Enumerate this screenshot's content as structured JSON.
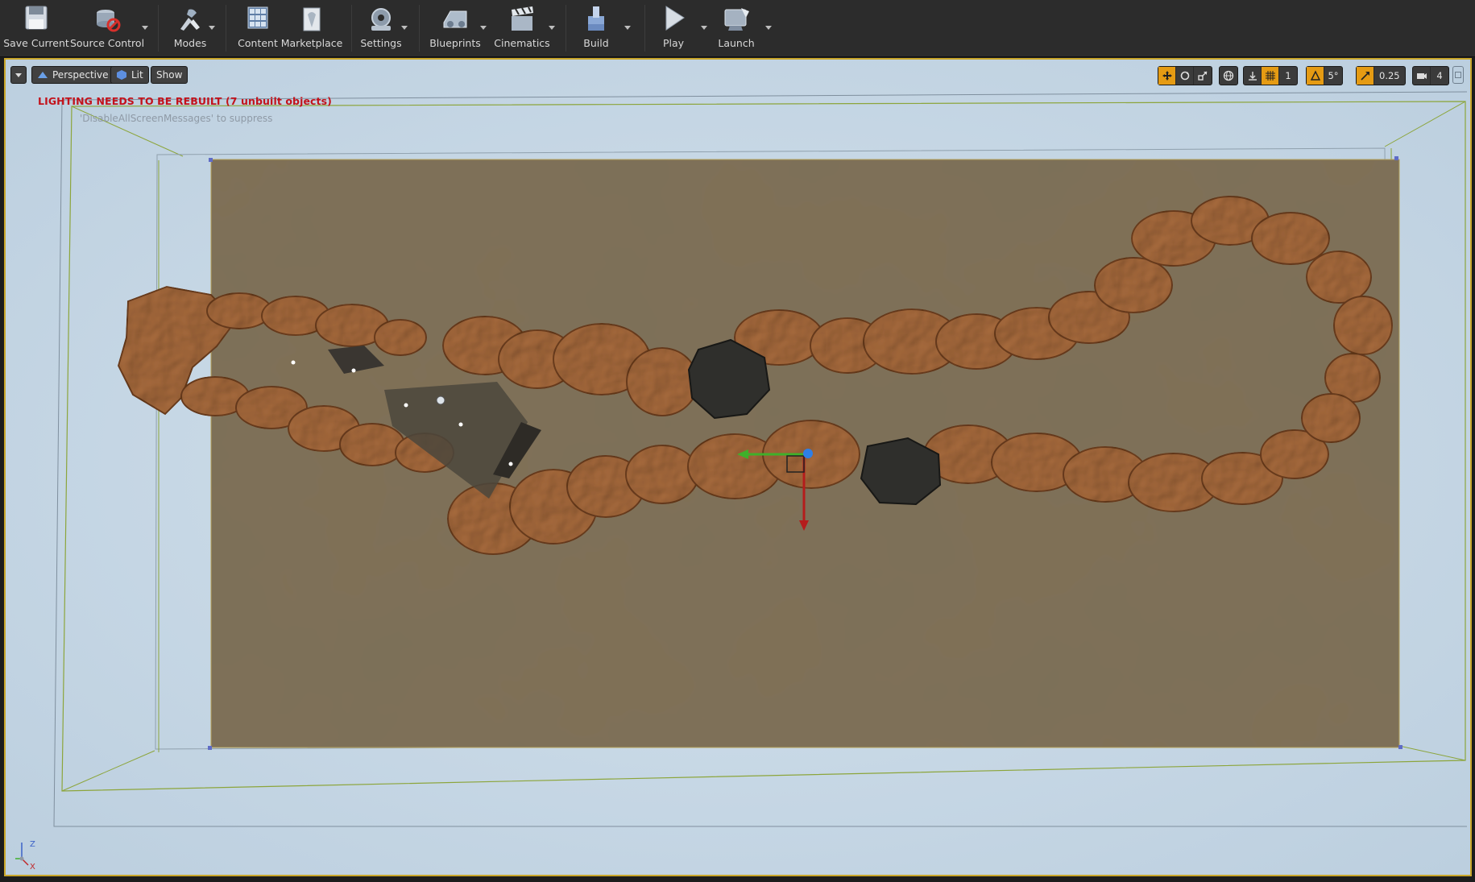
{
  "toolbar": {
    "items": [
      {
        "label": "Save Current",
        "icon": "save-icon"
      },
      {
        "label": "Source Control",
        "icon": "source-control-icon"
      },
      {
        "label": "Modes",
        "icon": "modes-icon"
      },
      {
        "label": "Content",
        "icon": "content-icon"
      },
      {
        "label": "Marketplace",
        "icon": "marketplace-icon"
      },
      {
        "label": "Settings",
        "icon": "settings-icon"
      },
      {
        "label": "Blueprints",
        "icon": "blueprints-icon"
      },
      {
        "label": "Cinematics",
        "icon": "cinematics-icon"
      },
      {
        "label": "Build",
        "icon": "build-icon"
      },
      {
        "label": "Play",
        "icon": "play-icon"
      },
      {
        "label": "Launch",
        "icon": "launch-icon"
      }
    ]
  },
  "viewport": {
    "view_mode": "Perspective",
    "lighting_mode": "Lit",
    "show_label": "Show",
    "snap": {
      "grid_size": "1",
      "rotation_snap": "5°",
      "scale_snap": "0.25",
      "camera_speed": "4"
    },
    "warning_text": "LIGHTING NEEDS TO BE REBUILT (7 unbuilt objects)",
    "suppress_text": "'DisableAllScreenMessages' to suppress",
    "axis_labels": {
      "z": "Z",
      "x": "X"
    }
  },
  "colors": {
    "toolbar_bg": "#2c2c2c",
    "viewport_bg": "#c7d8e6",
    "ground": "#786a50",
    "rock": "#a76a3c",
    "highlight": "#e59b13",
    "warning": "#c3121b"
  }
}
